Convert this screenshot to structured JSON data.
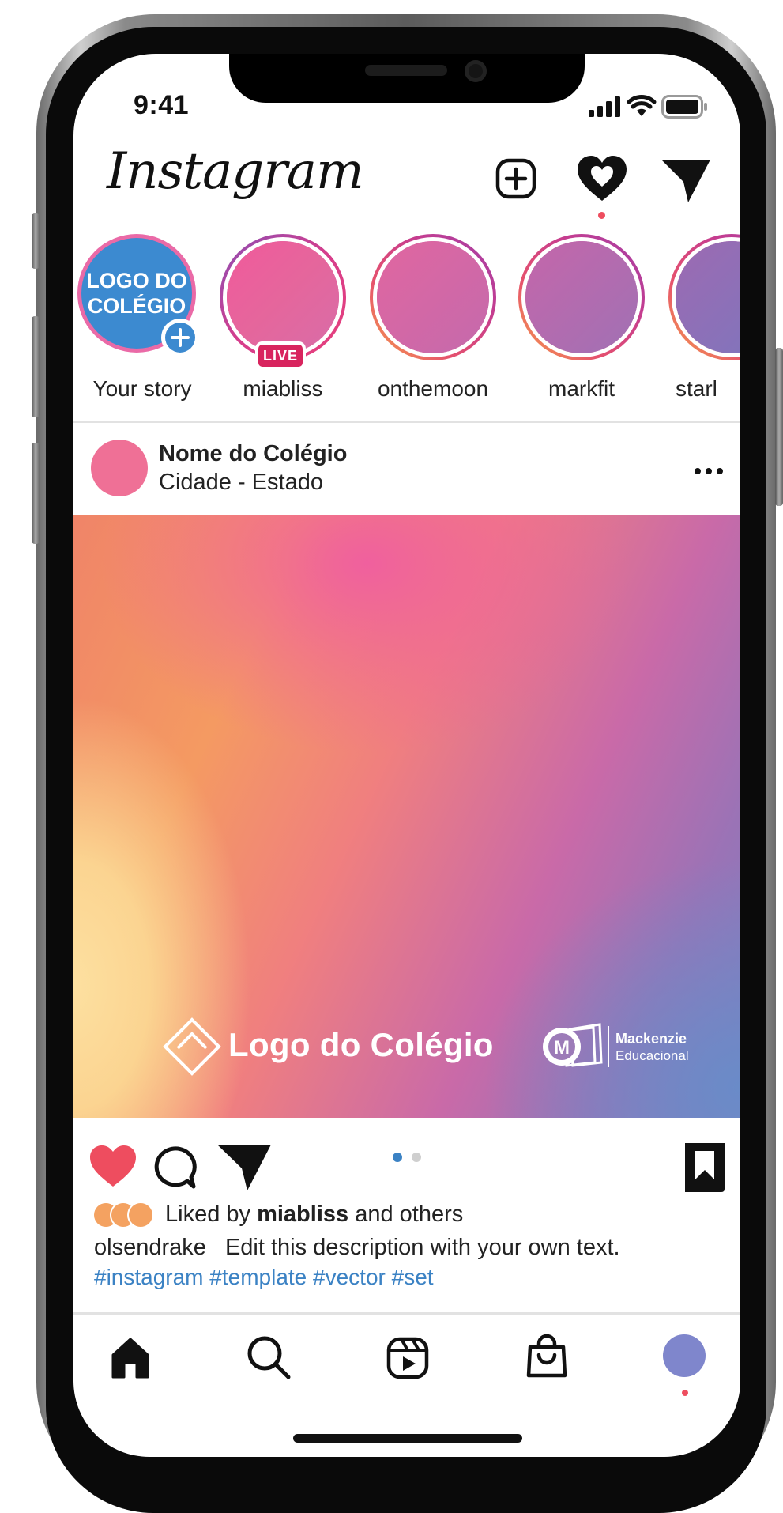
{
  "status_bar": {
    "time": "9:41"
  },
  "header": {
    "app_name": "Instagram"
  },
  "stories": [
    {
      "label": "Your story",
      "avatar_text_line1": "LOGO DO",
      "avatar_text_line2": "COLÉGIO",
      "has_add": true
    },
    {
      "label": "miabliss",
      "badge": "LIVE"
    },
    {
      "label": "onthemoon"
    },
    {
      "label": "markfit"
    },
    {
      "label": "starl"
    }
  ],
  "post": {
    "author": "Nome do Colégio",
    "location": "Cidade - Estado",
    "image_logo_text": "Logo do Colégio",
    "partner_line1": "Mackenzie",
    "partner_line2": "Educacional",
    "carousel": {
      "current": 1,
      "total": 2
    },
    "likes_prefix": "Liked by",
    "likes_user": "miabliss",
    "likes_suffix": "and others",
    "caption_user": "olsendrake",
    "caption_text": "Edit this description with your own text.",
    "hashtags": "#instagram #template #vector #set"
  },
  "bottom_nav": [
    "home",
    "search",
    "reels",
    "shop",
    "profile"
  ],
  "colors": {
    "accent_blue": "#3b82c4",
    "like_red": "#ee4d5f",
    "notification_dot": "#ee4d5f",
    "profile_avatar": "#7f86cc"
  }
}
